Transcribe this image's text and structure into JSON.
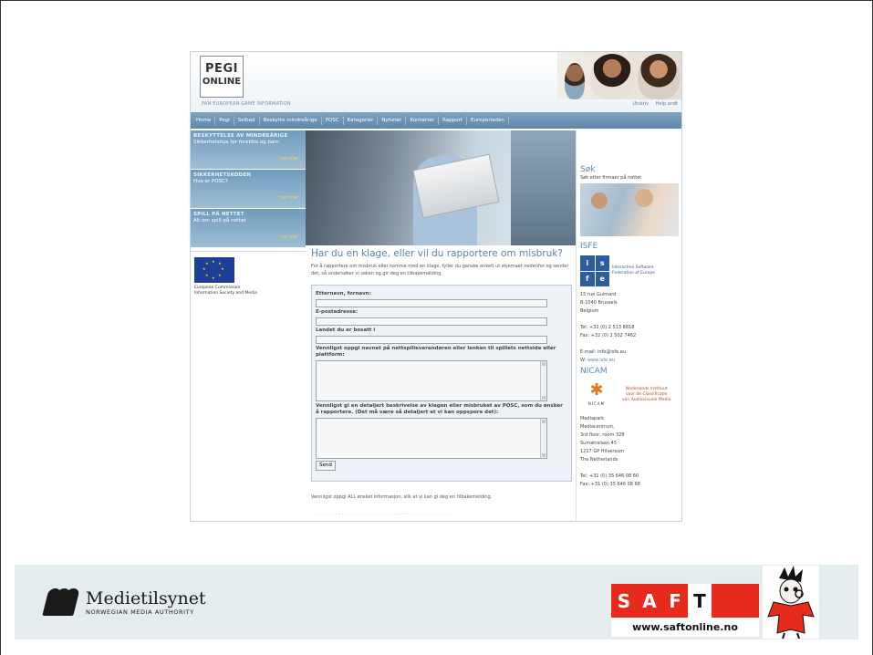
{
  "site": {
    "logo_line1": "PEGI",
    "logo_line2": "ONLINE",
    "tagline": "PAN EUROPEAN GAME INFORMATION",
    "header_links": [
      "Utskriv",
      "Help andt"
    ],
    "nav": [
      "Home",
      "Pegi",
      "Selbad",
      "Beskytte mindreårige",
      "POSC",
      "Kategorier",
      "Nyheter",
      "Kontakter",
      "Rapport",
      "Europeriaden"
    ],
    "promos": [
      {
        "title": "BESKYTTELSE AV MINDREÅRIGE",
        "sub": "Sikkerhetstips for foreldre og barn",
        "more": "Les mer"
      },
      {
        "title": "SIKKERHETSKODEN",
        "sub": "Hva er POSC?",
        "more": "Les mer"
      },
      {
        "title": "SPILL PÅ NETTET",
        "sub": "Alt om spill på nettet",
        "more": "Les mer"
      }
    ],
    "eu_caption": [
      "European Commission",
      "Information Society and Media"
    ],
    "main": {
      "title": "Har du en klage, eller vil du rapportere om misbruk?",
      "intro": "For å rapportere om misbruk eller komme med en klage, fyller du ganske enkelt ut skjemaet nedenfor og sender det, så undersøker vi saken og gir deg en tilbakemelding.",
      "labels": {
        "name": "Etternavn, fornavn:",
        "email": "E-postadresse:",
        "country": "Landet du er bosatt i",
        "provider": "Vennligst oppgi navnet på nettspilleverandøren eller lenken til spillets nettside eller plattform:",
        "details": "Vennligst gi en detaljert beskrivelse av klagen eller misbruket av POSC, som du ønsker å rapportere. (Det må være så detaljert at vi kan oppspore det):"
      },
      "send": "Send",
      "footer_note": "Vennligst oppgi ALL ønsket informasjon, slik at vi kan gi deg en tilbakemelding."
    },
    "right": {
      "search_head": "Søk",
      "search_text": "Søk etter firmaer på nettet",
      "isfe_head": "ISFE",
      "isfe_letters": [
        "i",
        "s",
        "f",
        "e"
      ],
      "isfe_name": [
        "Interactive Software",
        "Federation of Europe"
      ],
      "isfe_addr": [
        "15 rue Guimard",
        "B-1040 Brussels",
        "Belgium"
      ],
      "isfe_tel": "Tel: +32 (0) 2 513 8818",
      "isfe_fax": "Fax: +32 (0) 2 502 7462",
      "isfe_email": "E-mail: info@isfe.eu",
      "isfe_web": "www.isfe.eu",
      "isfe_web_prefix": "W:",
      "nicam_head": "NICAM",
      "nicam_word": "NICAM",
      "nicam_name": [
        "Nederlands Instituut",
        "voor de Classificatie",
        "van Audiovisuele Media"
      ],
      "nicam_addr": [
        "Mediapark",
        "Mediacentrum,",
        "3rd floor, room 328",
        "Sumatralaan 45",
        "1217 GP Hilversum",
        "The Netherlands"
      ],
      "nicam_tel": "Tel: +31 (0) 35 646 08 60",
      "nicam_fax": "Fax: +31 (0) 35 646 08 68"
    }
  },
  "footer": {
    "medietilsynet_name": "Medietilsynet",
    "medietilsynet_sub": "NORWEGIAN MEDIA AUTHORITY",
    "saft_letters": [
      "S",
      "A",
      "F",
      "T"
    ],
    "saft_url": "www.saftonline.no"
  },
  "colors": {
    "nav_blue": "#5e87a9",
    "title_blue": "#5b82a8",
    "saft_red": "#e62b1d",
    "footer_band": "#e4ecf0"
  }
}
